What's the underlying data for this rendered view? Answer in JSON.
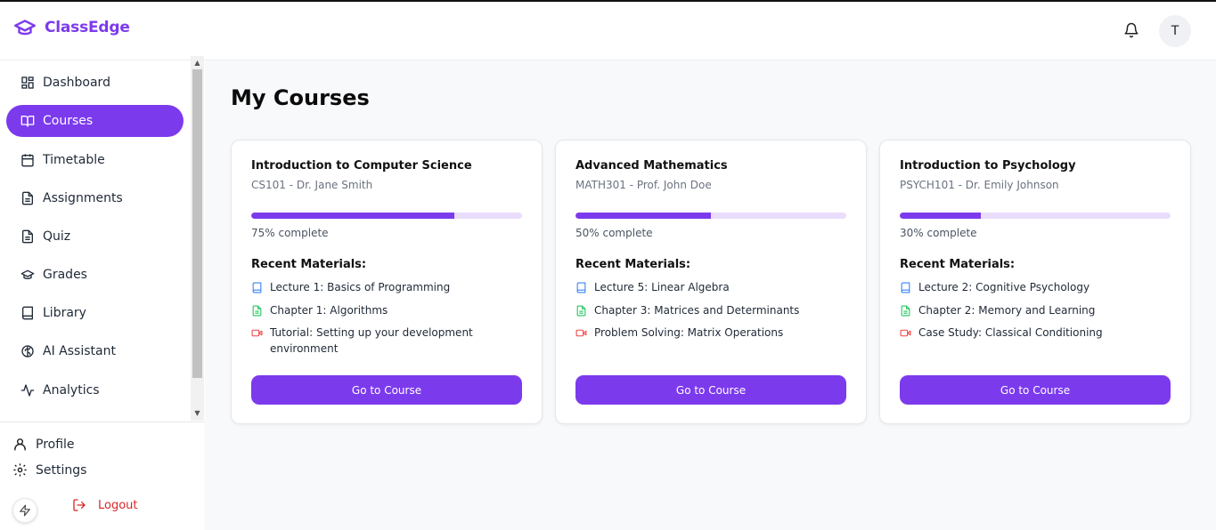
{
  "app": {
    "name": "ClassEdge",
    "avatar_initial": "T"
  },
  "sidebar": {
    "items": [
      {
        "label": "Dashboard",
        "icon": "dashboard-icon"
      },
      {
        "label": "Courses",
        "icon": "book-open-icon",
        "active": true
      },
      {
        "label": "Timetable",
        "icon": "calendar-icon"
      },
      {
        "label": "Assignments",
        "icon": "file-text-icon"
      },
      {
        "label": "Quiz",
        "icon": "file-text-icon"
      },
      {
        "label": "Grades",
        "icon": "graduation-cap-icon"
      },
      {
        "label": "Library",
        "icon": "book-icon"
      },
      {
        "label": "AI Assistant",
        "icon": "brain-icon"
      },
      {
        "label": "Analytics",
        "icon": "activity-icon"
      }
    ],
    "profile_label": "Profile",
    "settings_label": "Settings",
    "logout_label": "Logout"
  },
  "main": {
    "title": "My Courses",
    "materials_heading": "Recent Materials:",
    "button_label": "Go to Course",
    "courses": [
      {
        "title": "Introduction to Computer Science",
        "subtitle": "CS101 - Dr. Jane Smith",
        "progress": 75,
        "progress_text": "75% complete",
        "materials": [
          {
            "type": "book",
            "label": "Lecture 1: Basics of Programming"
          },
          {
            "type": "document",
            "label": "Chapter 1: Algorithms"
          },
          {
            "type": "video",
            "label": "Tutorial: Setting up your development environment"
          }
        ]
      },
      {
        "title": "Advanced Mathematics",
        "subtitle": "MATH301 - Prof. John Doe",
        "progress": 50,
        "progress_text": "50% complete",
        "materials": [
          {
            "type": "book",
            "label": "Lecture 5: Linear Algebra"
          },
          {
            "type": "document",
            "label": "Chapter 3: Matrices and Determinants"
          },
          {
            "type": "video",
            "label": "Problem Solving: Matrix Operations"
          }
        ]
      },
      {
        "title": "Introduction to Psychology",
        "subtitle": "PSYCH101 - Dr. Emily Johnson",
        "progress": 30,
        "progress_text": "30% complete",
        "materials": [
          {
            "type": "book",
            "label": "Lecture 2: Cognitive Psychology"
          },
          {
            "type": "document",
            "label": "Chapter 2: Memory and Learning"
          },
          {
            "type": "video",
            "label": "Case Study: Classical Conditioning"
          }
        ]
      }
    ]
  },
  "colors": {
    "accent": "#7c3aed",
    "book_icon": "#3b82f6",
    "document_icon": "#22c55e",
    "video_icon": "#ef4444",
    "logout": "#dc2626"
  }
}
